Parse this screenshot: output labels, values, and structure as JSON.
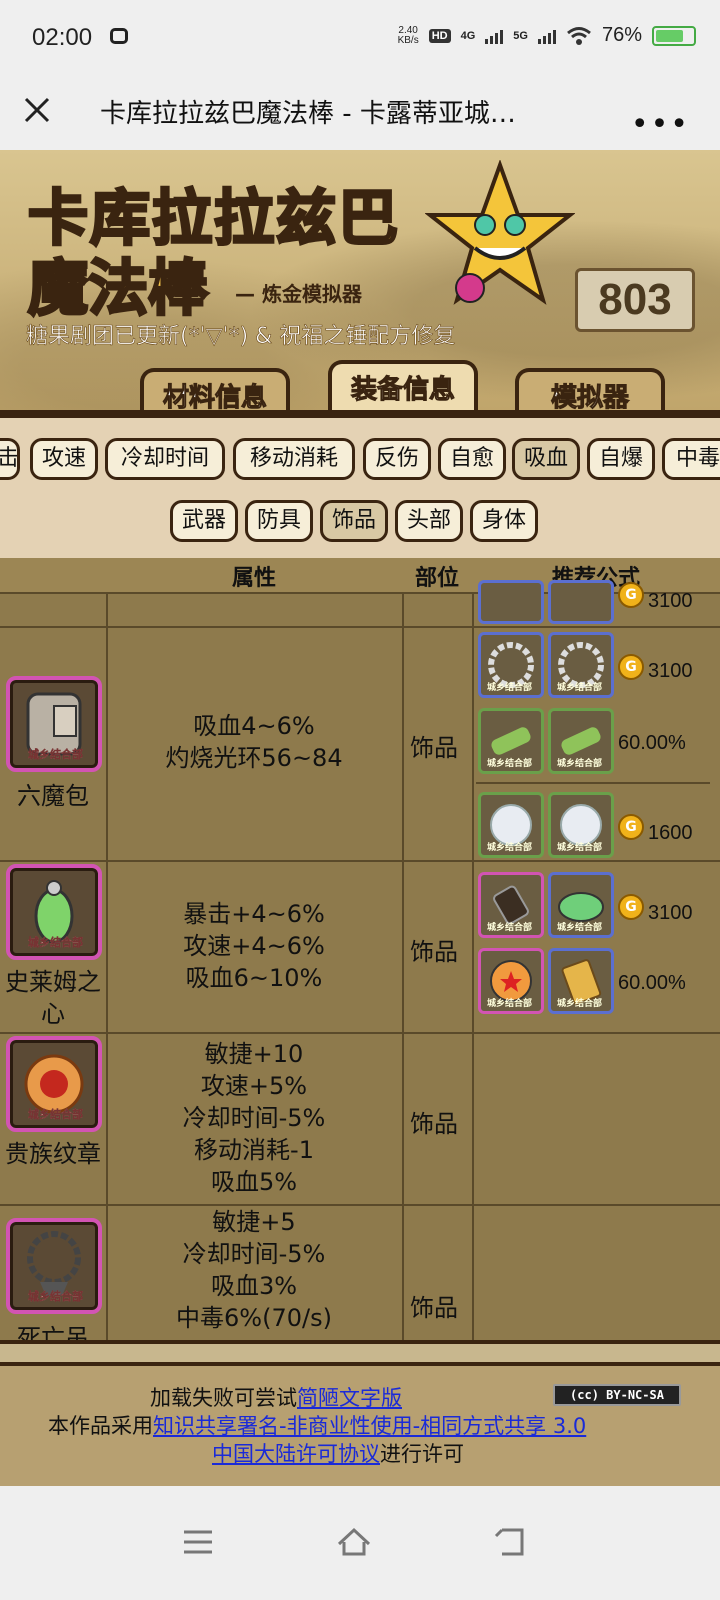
{
  "status": {
    "time": "02:00",
    "speed_value": "2.40",
    "speed_unit": "KB/s",
    "hd": "HD",
    "net1": "4G",
    "net2": "5G",
    "battery": "76%",
    "battery_level": 0.76
  },
  "browser": {
    "title": "卡库拉拉兹巴魔法棒 - 卡露蒂亚城…",
    "more": "•••"
  },
  "banner": {
    "logo_line1": "卡库拉拉兹巴",
    "logo_line2": "魔法棒",
    "subtitle": "— 炼金模拟器",
    "notice": "糖果剧团已更新(*ˈ▽ˈ*) & 祝福之锤配方修复",
    "count": "803",
    "tabs": [
      "材料信息",
      "装备信息",
      "模拟器"
    ]
  },
  "filters": {
    "row1": [
      "击",
      "攻速",
      "冷却时间",
      "移动消耗",
      "反伤",
      "自愈",
      "吸血",
      "自爆",
      "中毒"
    ],
    "row2": [
      "武器",
      "防具",
      "饰品",
      "头部",
      "身体"
    ]
  },
  "table": {
    "headers": [
      "属性",
      "部位",
      "推荐公式"
    ],
    "top_partial_value": "3100",
    "rows": [
      {
        "name": "六魔包",
        "attrs": [
          "吸血4~6%",
          "灼烧光环56~84"
        ],
        "slot": "饰品",
        "formulas": [
          {
            "value": "3100",
            "coin": true
          },
          {
            "value": "60.00%",
            "coin": false
          },
          {
            "value": "1600",
            "coin": true
          }
        ]
      },
      {
        "name": "史莱姆之心",
        "attrs": [
          "暴击+4~6%",
          "攻速+4~6%",
          "吸血6~10%"
        ],
        "slot": "饰品",
        "formulas": [
          {
            "value": "3100",
            "coin": true
          },
          {
            "value": "60.00%",
            "coin": false
          }
        ]
      },
      {
        "name": "贵族纹章",
        "attrs": [
          "敏捷+10",
          "攻速+5%",
          "冷却时间-5%",
          "移动消耗-1",
          "吸血5%"
        ],
        "slot": "饰品",
        "formulas": []
      },
      {
        "name": "死亡吊",
        "attrs": [
          "敏捷+5",
          "冷却时间-5%",
          "吸血3%",
          "中毒6%(70/s)"
        ],
        "slot": "饰品",
        "formulas": []
      }
    ],
    "icon_tag": "城乡结合部",
    "coin_letter": "G"
  },
  "footer": {
    "line1_prefix": "加载失败可尝试",
    "line1_link": "简陋文字版",
    "line2_prefix": "本作品采用",
    "line2_link": "知识共享署名-非商业性使用-相同方式共享 3.0",
    "line3_link": "中国大陆许可协议",
    "line3_suffix": "进行许可",
    "cc_badge": "(cc) BY-NC-SA"
  },
  "colors": {
    "banner": "#c9b27a",
    "table_bg": "#8e7a4c",
    "filter_bg": "#e4d2b4",
    "frame_pink": "#d254b3",
    "frame_blue": "#5b6fd0",
    "frame_green": "#6aa04a",
    "link": "#1a2ad8"
  }
}
